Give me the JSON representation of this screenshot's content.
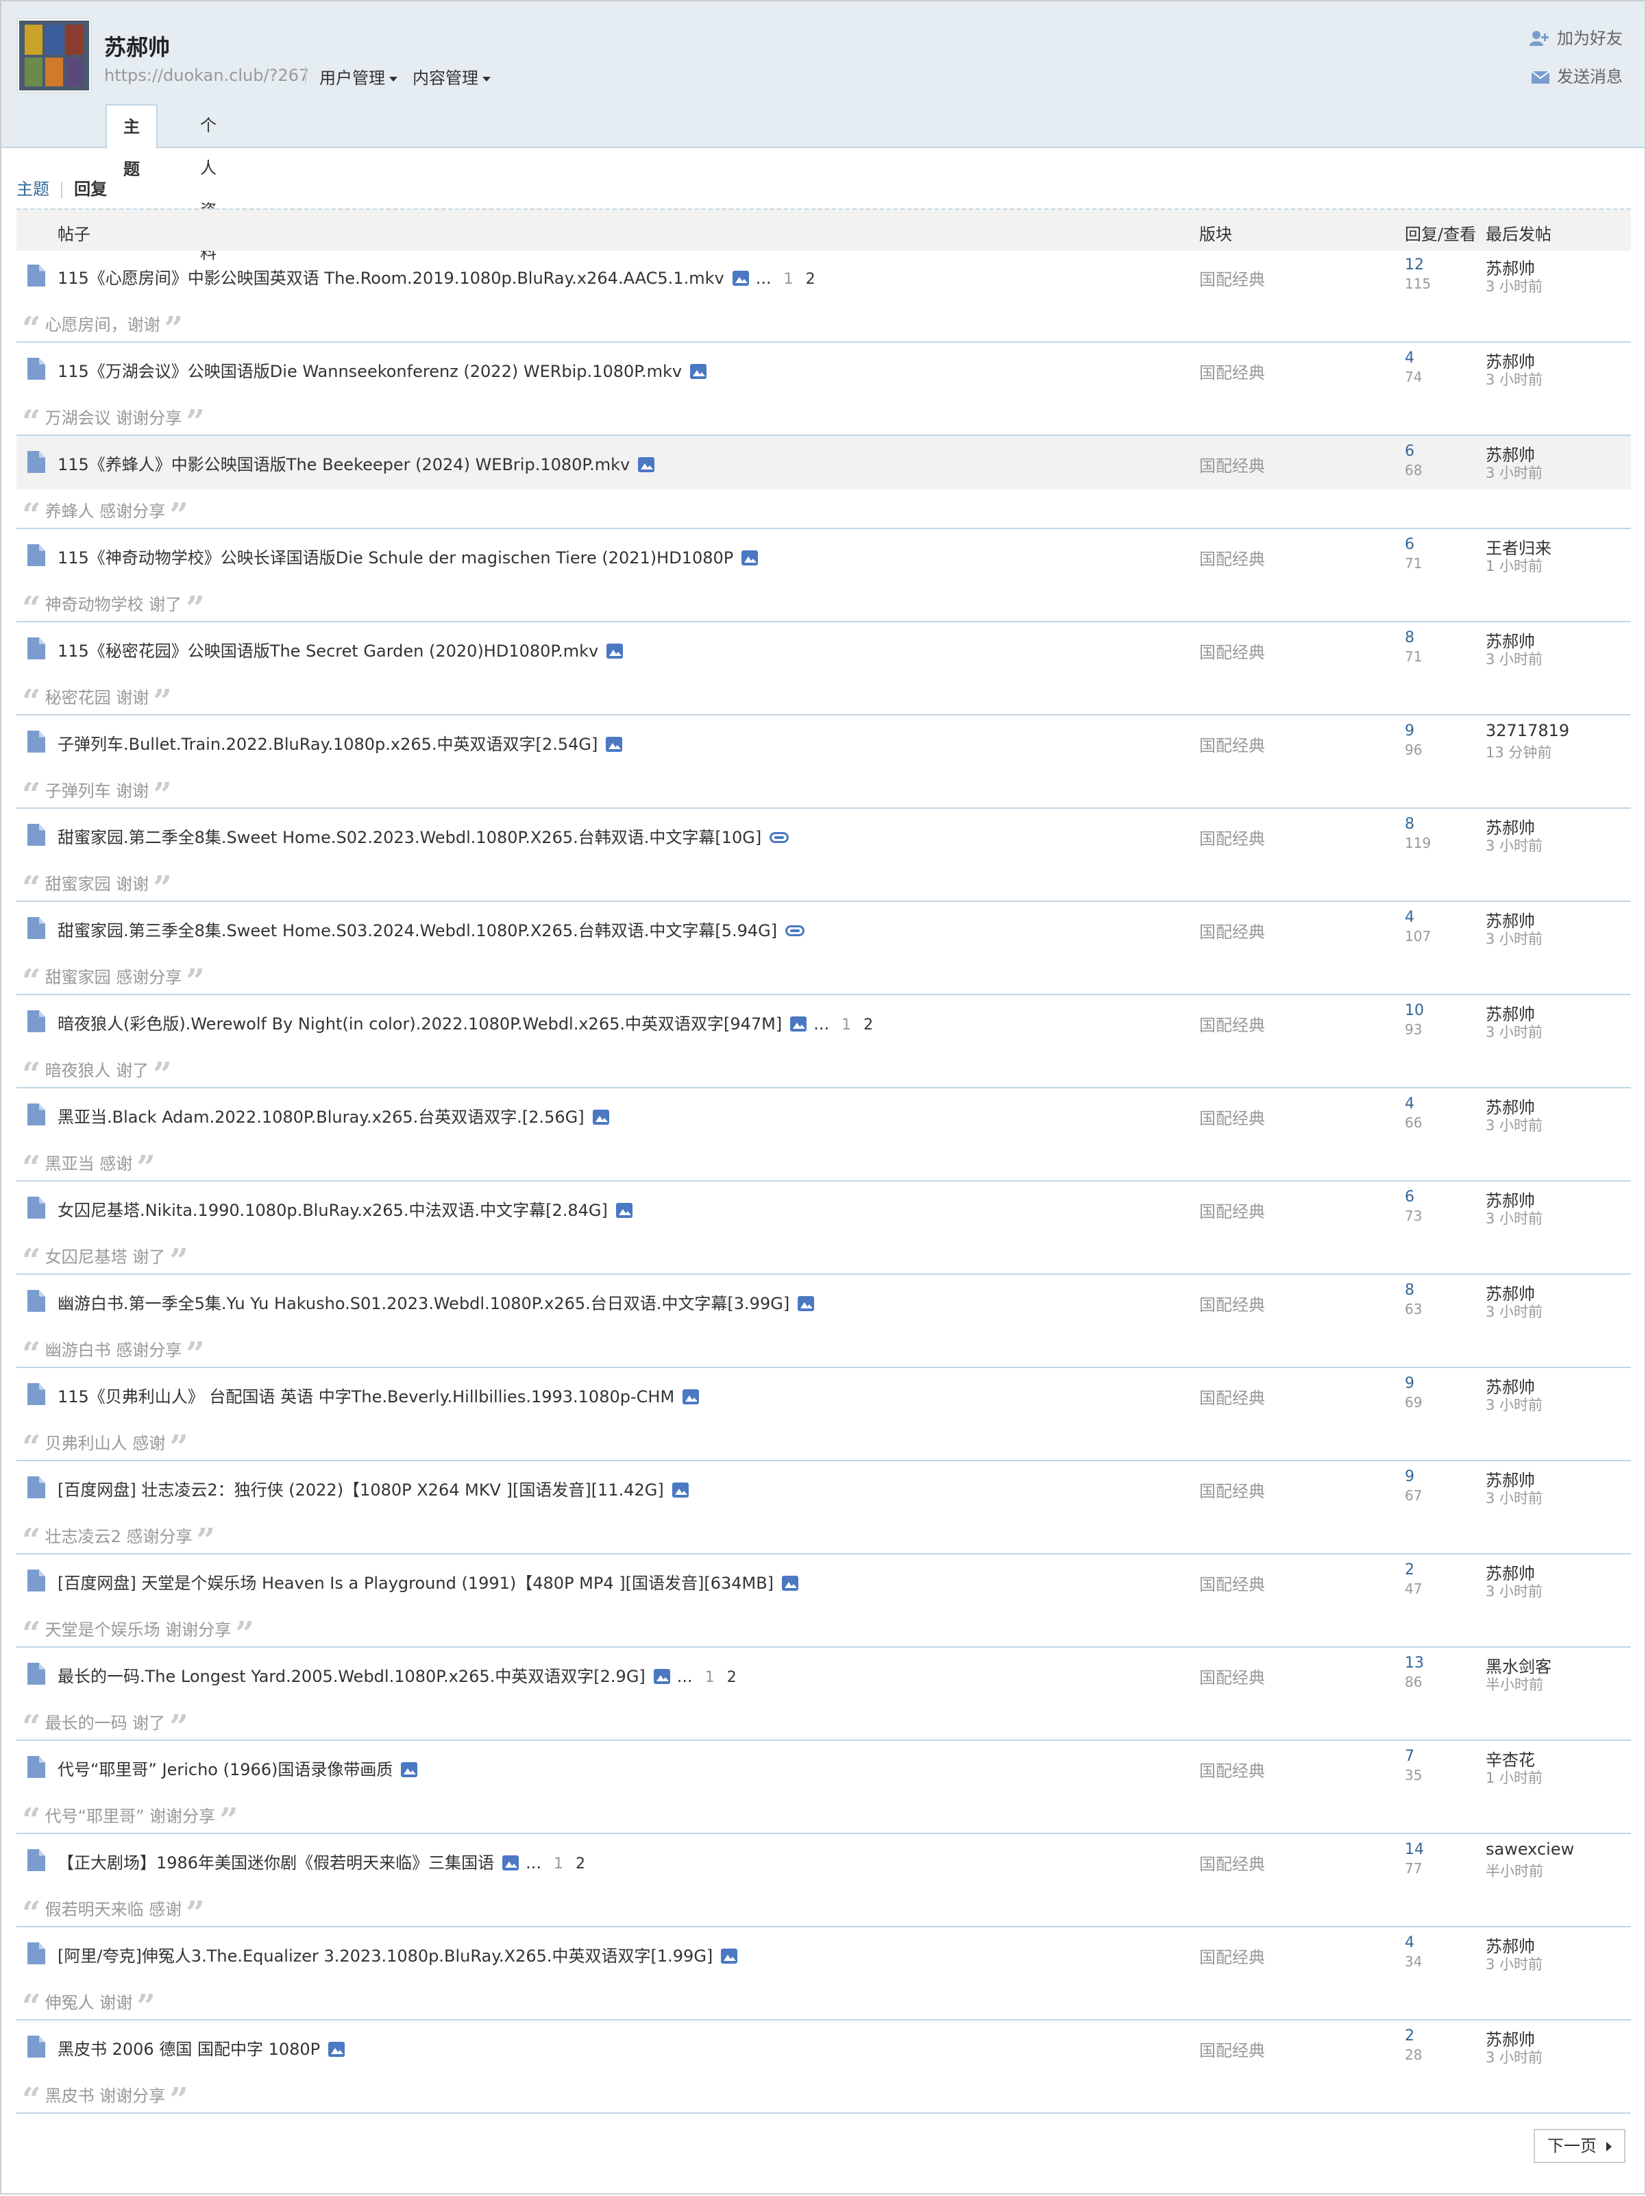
{
  "header": {
    "username": "苏郝帅",
    "url": "https://duokan.club/?267",
    "menu_user": "用户管理",
    "menu_content": "内容管理",
    "add_friend": "加为好友",
    "send_message": "发送消息",
    "tabs": [
      {
        "label": "主题"
      },
      {
        "label": "个人资料"
      }
    ]
  },
  "subnav": {
    "threads": "主题",
    "replies": "回复"
  },
  "table": {
    "headers": {
      "post": "帖子",
      "forum": "版块",
      "replies_views": "回复/查看",
      "last_post": "最后发帖"
    },
    "rows": [
      {
        "title": "115《心愿房间》中影公映国英双语 The.Room.2019.1080p.BluRay.x264.AAC5.1.mkv",
        "icon": "image-icon",
        "pages": true,
        "forum": "国配经典",
        "replies": "12",
        "views": "115",
        "last_user": "苏郝帅",
        "last_time": "3 小时前",
        "quote": "心愿房间，谢谢"
      },
      {
        "title": "115《万湖会议》公映国语版Die Wannseekonferenz (2022) WERbip.1080P.mkv",
        "icon": "image-icon",
        "pages": false,
        "forum": "国配经典",
        "replies": "4",
        "views": "74",
        "last_user": "苏郝帅",
        "last_time": "3 小时前",
        "quote": "万湖会议 谢谢分享"
      },
      {
        "title": "115《养蜂人》中影公映国语版The Beekeeper (2024) WEBrip.1080P.mkv",
        "icon": "image-icon",
        "pages": false,
        "forum": "国配经典",
        "replies": "6",
        "views": "68",
        "last_user": "苏郝帅",
        "last_time": "3 小时前",
        "quote": "养蜂人 感谢分享"
      },
      {
        "title": "115《神奇动物学校》公映长译国语版Die Schule der magischen Tiere (2021)HD1080P",
        "icon": "image-icon",
        "pages": false,
        "forum": "国配经典",
        "replies": "6",
        "views": "71",
        "last_user": "王者归来",
        "last_time": "1 小时前",
        "quote": "神奇动物学校 谢了"
      },
      {
        "title": "115《秘密花园》公映国语版The Secret Garden (2020)HD1080P.mkv",
        "icon": "image-icon",
        "pages": false,
        "forum": "国配经典",
        "replies": "8",
        "views": "71",
        "last_user": "苏郝帅",
        "last_time": "3 小时前",
        "quote": "秘密花园 谢谢"
      },
      {
        "title": "子弹列车.Bullet.Train.2022.BluRay.1080p.x265.中英双语双字[2.54G]",
        "icon": "image-icon",
        "pages": false,
        "forum": "国配经典",
        "replies": "9",
        "views": "96",
        "last_user": "32717819",
        "last_time": "13 分钟前",
        "quote": "子弹列车 谢谢"
      },
      {
        "title": "甜蜜家园.第二季全8集.Sweet Home.S02.2023.Webdl.1080P.X265.台韩双语.中文字幕[10G]",
        "icon": "attachment-icon",
        "pages": false,
        "forum": "国配经典",
        "replies": "8",
        "views": "119",
        "last_user": "苏郝帅",
        "last_time": "3 小时前",
        "quote": "甜蜜家园 谢谢"
      },
      {
        "title": "甜蜜家园.第三季全8集.Sweet Home.S03.2024.Webdl.1080P.X265.台韩双语.中文字幕[5.94G]",
        "icon": "attachment-icon",
        "pages": false,
        "forum": "国配经典",
        "replies": "4",
        "views": "107",
        "last_user": "苏郝帅",
        "last_time": "3 小时前",
        "quote": "甜蜜家园 感谢分享"
      },
      {
        "title": "暗夜狼人(彩色版).Werewolf By Night(in color).2022.1080P.Webdl.x265.中英双语双字[947M]",
        "icon": "image-icon",
        "pages": true,
        "forum": "国配经典",
        "replies": "10",
        "views": "93",
        "last_user": "苏郝帅",
        "last_time": "3 小时前",
        "quote": "暗夜狼人 谢了"
      },
      {
        "title": "黑亚当.Black Adam.2022.1080P.Bluray.x265.台英双语双字.[2.56G]",
        "icon": "image-icon",
        "pages": false,
        "forum": "国配经典",
        "replies": "4",
        "views": "66",
        "last_user": "苏郝帅",
        "last_time": "3 小时前",
        "quote": "黑亚当 感谢"
      },
      {
        "title": "女囚尼基塔.Nikita.1990.1080p.BluRay.x265.中法双语.中文字幕[2.84G]",
        "icon": "image-icon",
        "pages": false,
        "forum": "国配经典",
        "replies": "6",
        "views": "73",
        "last_user": "苏郝帅",
        "last_time": "3 小时前",
        "quote": "女囚尼基塔 谢了"
      },
      {
        "title": "幽游白书.第一季全5集.Yu Yu Hakusho.S01.2023.Webdl.1080P.x265.台日双语.中文字幕[3.99G]",
        "icon": "image-icon",
        "pages": false,
        "forum": "国配经典",
        "replies": "8",
        "views": "63",
        "last_user": "苏郝帅",
        "last_time": "3 小时前",
        "quote": "幽游白书 感谢分享"
      },
      {
        "title": "115《贝弗利山人》 台配国语 英语 中字The.Beverly.Hillbillies.1993.1080p-CHM",
        "icon": "image-icon",
        "pages": false,
        "forum": "国配经典",
        "replies": "9",
        "views": "69",
        "last_user": "苏郝帅",
        "last_time": "3 小时前",
        "quote": "贝弗利山人 感谢"
      },
      {
        "title": "[百度网盘] 壮志凌云2：独行侠 (2022)【1080P X264 MKV ][国语发音][11.42G]",
        "icon": "image-icon",
        "pages": false,
        "forum": "国配经典",
        "replies": "9",
        "views": "67",
        "last_user": "苏郝帅",
        "last_time": "3 小时前",
        "quote": "壮志凌云2 感谢分享"
      },
      {
        "title": "[百度网盘] 天堂是个娱乐场 Heaven Is a Playground (1991)【480P MP4 ][国语发音][634MB]",
        "icon": "image-icon",
        "pages": false,
        "forum": "国配经典",
        "replies": "2",
        "views": "47",
        "last_user": "苏郝帅",
        "last_time": "3 小时前",
        "quote": "天堂是个娱乐场 谢谢分享"
      },
      {
        "title": "最长的一码.The Longest Yard.2005.Webdl.1080P.x265.中英双语双字[2.9G]",
        "icon": "image-icon",
        "pages": true,
        "forum": "国配经典",
        "replies": "13",
        "views": "86",
        "last_user": "黑水剑客",
        "last_time": "半小时前",
        "quote": "最长的一码 谢了"
      },
      {
        "title": "代号“耶里哥” Jericho (1966)国语录像带画质",
        "icon": "image-icon",
        "pages": false,
        "forum": "国配经典",
        "replies": "7",
        "views": "35",
        "last_user": "辛杏花",
        "last_time": "1 小时前",
        "quote": "代号“耶里哥” 谢谢分享"
      },
      {
        "title": "【正大剧场】1986年美国迷你剧《假若明天来临》三集国语",
        "icon": "image-icon",
        "pages": true,
        "forum": "国配经典",
        "replies": "14",
        "views": "77",
        "last_user": "sawexciew",
        "last_time": "半小时前",
        "quote": "假若明天来临 感谢"
      },
      {
        "title": "[阿里/夸克]伸冤人3.The.Equalizer 3.2023.1080p.BluRay.X265.中英双语双字[1.99G]",
        "icon": "image-icon",
        "pages": false,
        "forum": "国配经典",
        "replies": "4",
        "views": "34",
        "last_user": "苏郝帅",
        "last_time": "3 小时前",
        "quote": "伸冤人 谢谢"
      },
      {
        "title": "黑皮书 2006 德国 国配中字 1080P",
        "icon": "image-icon",
        "pages": false,
        "forum": "国配经典",
        "replies": "2",
        "views": "28",
        "last_user": "苏郝帅",
        "last_time": "3 小时前",
        "quote": "黑皮书 谢谢分享"
      }
    ],
    "pager": {
      "ellipsis": "...",
      "p1": "1",
      "p2": "2"
    }
  },
  "pagination": {
    "next": "下一页"
  },
  "colors": {
    "link": "#336699",
    "header_bg": "#e5edf2",
    "border": "#c2d5e3",
    "icon": "#4a78c2"
  }
}
